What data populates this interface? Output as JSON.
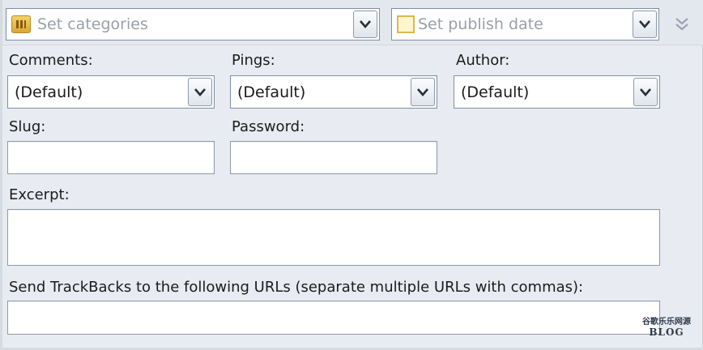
{
  "categories": {
    "placeholder": "Set categories",
    "icon": "folder-icon"
  },
  "publish_date": {
    "placeholder": "Set publish date",
    "icon": "calendar-icon"
  },
  "collapse": {
    "icon": "double-chevron-down-icon"
  },
  "comments": {
    "label": "Comments:",
    "value": "(Default)"
  },
  "pings": {
    "label": "Pings:",
    "value": "(Default)"
  },
  "author": {
    "label": "Author:",
    "value": "(Default)"
  },
  "slug": {
    "label": "Slug:",
    "value": ""
  },
  "password": {
    "label": "Password:",
    "value": ""
  },
  "excerpt": {
    "label": "Excerpt:",
    "value": ""
  },
  "trackbacks": {
    "label": "Send TrackBacks to the following URLs (separate multiple URLs with commas):",
    "value": ""
  },
  "watermark": {
    "line1": "谷歌乐乐网源",
    "line2": "BLOG"
  }
}
